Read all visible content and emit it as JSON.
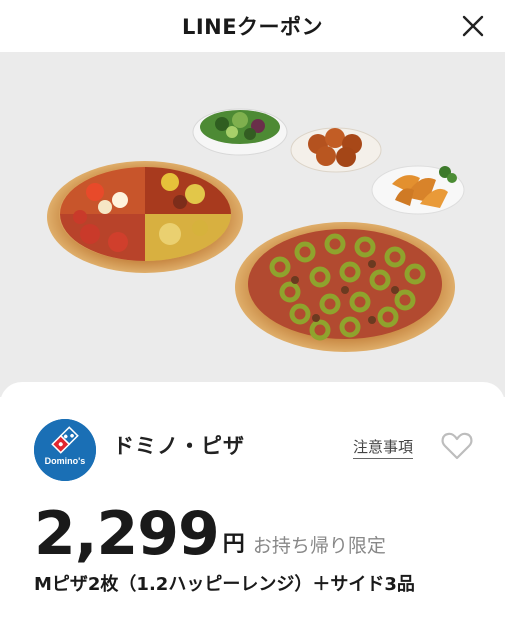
{
  "header": {
    "title": "LINEクーポン"
  },
  "brand": {
    "name": "ドミノ・ピザ",
    "logo_text": "Domino's",
    "notice_label": "注意事項"
  },
  "offer": {
    "price": "2,299",
    "currency": "円",
    "condition": "お持ち帰り限定",
    "title": "Mピザ2枚（1.2ハッピーレンジ）＋サイド3品"
  },
  "colors": {
    "brand_blue": "#1a6fb5",
    "brand_red": "#e0262f"
  }
}
